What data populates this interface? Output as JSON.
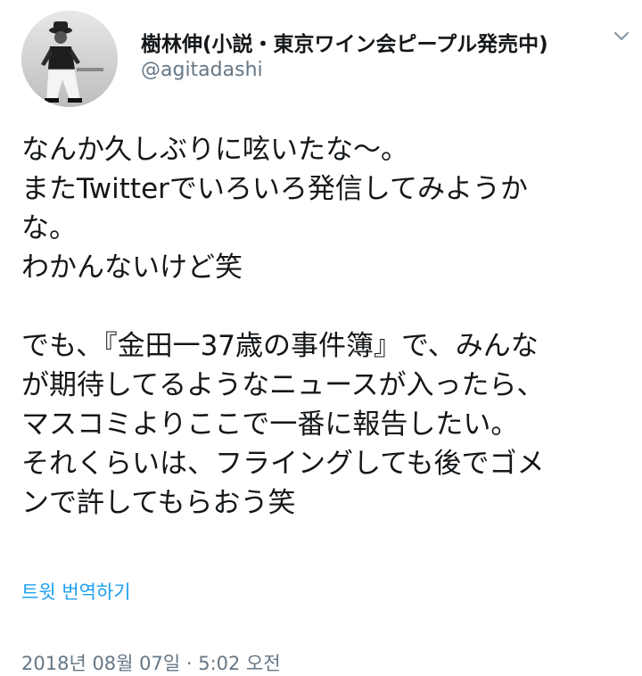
{
  "author": {
    "display_name": "樹林伸(小説・東京ワイン会ピープル発売中)",
    "handle": "@agitadashi",
    "avatar_icon": "profile-photo"
  },
  "menu_icon": "chevron-down-icon",
  "tweet": {
    "lines": [
      "なんか久しぶりに呟いたな〜。",
      "またTwitterでいろいろ発信してみようか",
      "な。",
      "わかんないけど笑",
      "",
      "でも、『金田一37歳の事件簿』で、みんな",
      "が期待してるようなニュースが入ったら、",
      "マスコミよりここで一番に報告したい。",
      "それくらいは、フライングしても後でゴメ",
      "ンで許してもらおう笑"
    ]
  },
  "translate_label": "트윗 번역하기",
  "timestamp": "2018년 08월 07일 · 5:02 오전",
  "colors": {
    "text": "#14171a",
    "secondary": "#657786",
    "link": "#1da1f2"
  }
}
